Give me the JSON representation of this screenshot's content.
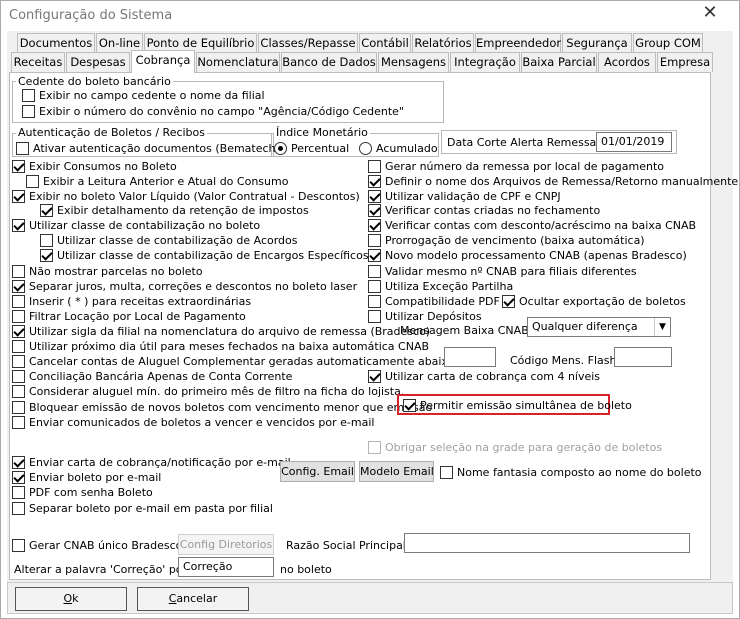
{
  "window": {
    "title": "Configuração do Sistema",
    "close_glyph": "✕"
  },
  "tabs_row1": [
    "Documentos",
    "On-line",
    "Ponto de Equilíbrio",
    "Classes/Repasse",
    "Contábil",
    "Relatórios",
    "Empreendedor",
    "Segurança",
    "Group COM"
  ],
  "tabs_row2": [
    "Receitas",
    "Despesas",
    "Cobrança",
    "Nomenclatura",
    "Banco de Dados",
    "Mensagens",
    "Integração",
    "Baixa Parcial",
    "Acordos",
    "Empresa"
  ],
  "active_tab": "Cobrança",
  "cedente": {
    "title": "Cedente do boleto bancário",
    "opt1": {
      "label": "Exibir no campo cedente o nome da filial",
      "checked": false
    },
    "opt2": {
      "label": "Exibir o número do convênio no campo \"Agência/Código Cedente\"",
      "checked": false
    }
  },
  "autent": {
    "title": "Autenticação de Boletos / Recibos",
    "opt": {
      "label": "Ativar autenticação documentos (Bematech)",
      "checked": false
    }
  },
  "indice": {
    "title": "Índice Monetário",
    "percentual": "Percentual",
    "acumulado": "Acumulado",
    "selected": "Percentual"
  },
  "data_corte": {
    "label": "Data Corte Alerta Remessa",
    "value": "01/01/2019"
  },
  "left_options": [
    {
      "label": "Exibir Consumos no Boleto",
      "checked": true
    },
    {
      "label": "Exibir a Leitura Anterior e Atual do Consumo",
      "checked": false
    },
    {
      "label": "Exibir no boleto Valor Líquido (Valor Contratual - Descontos)",
      "checked": true
    },
    {
      "label": "Exibir detalhamento da retenção de impostos",
      "checked": true
    },
    {
      "label": "Utilizar classe de contabilização no boleto",
      "checked": true
    },
    {
      "label": "Utilizar classe de contabilização de Acordos",
      "checked": false
    },
    {
      "label": "Utilizar classe de contabilização de Encargos Específicos",
      "checked": true
    },
    {
      "label": "Não mostrar parcelas no boleto",
      "checked": false
    },
    {
      "label": "Separar juros, multa, correções e descontos no boleto laser",
      "checked": true
    },
    {
      "label": "Inserir ( * ) para receitas extraordinárias",
      "checked": false
    },
    {
      "label": "Filtrar Locação por Local de Pagamento",
      "checked": false
    },
    {
      "label": "Utilizar sigla da filial na nomenclatura do arquivo de remessa (Bradesco)",
      "checked": true
    },
    {
      "label": "Utilizar próximo dia útil para meses fechados na baixa automática CNAB",
      "checked": false
    },
    {
      "label": "Cancelar contas de Aluguel Complementar geradas automaticamente abaixo de R$",
      "checked": false
    },
    {
      "label": "Conciliação Bancária Apenas de Conta Corrente",
      "checked": false
    },
    {
      "label": "Considerar aluguel mín. do primeiro mês de filtro na ficha do lojista.",
      "checked": false
    },
    {
      "label": "Bloquear emissão de novos boletos com vencimento menor que emissão",
      "checked": false
    },
    {
      "label": "Enviar comunicados de boletos a vencer e vencidos por e-mail",
      "checked": false
    }
  ],
  "right_options": [
    {
      "label": "Gerar número da remessa por local de pagamento",
      "checked": false
    },
    {
      "label": "Definir o nome dos Arquivos de Remessa/Retorno manualmente",
      "checked": true
    },
    {
      "label": "Utilizar validação de CPF e CNPJ",
      "checked": true
    },
    {
      "label": "Verificar contas criadas no fechamento",
      "checked": true
    },
    {
      "label": "Verificar contas com desconto/acréscimo na baixa CNAB",
      "checked": true
    },
    {
      "label": "Prorrogação de vencimento (baixa automática)",
      "checked": false
    },
    {
      "label": "Novo modelo processamento CNAB (apenas Bradesco)",
      "checked": true
    },
    {
      "label": "Validar mesmo nº CNAB para filiais diferentes",
      "checked": false
    },
    {
      "label": "Utiliza Exceção Partilha",
      "checked": false
    },
    {
      "label": "Compatibilidade PDF",
      "checked": false
    },
    {
      "label": "Utilizar Depósitos",
      "checked": false
    }
  ],
  "ocultar_exportacao": {
    "label": "Ocultar exportação de boletos",
    "checked": true
  },
  "mensagem_baixa": {
    "label": "Mensagem Baixa CNAB:",
    "value": "Qualquer diferença"
  },
  "codigo_mens": {
    "label": "Código Mens. Flash:",
    "value": ""
  },
  "valor_rs": "",
  "carta_4_niveis": {
    "label": "Utilizar carta de cobrança com 4 níveis",
    "checked": true
  },
  "permitir_simultanea": {
    "label": "Permitir emissão simultânea de boleto",
    "checked": true
  },
  "obrigar_selecao": {
    "label": "Obrigar seleção na grade para geração de boletos",
    "checked": false
  },
  "email_options": [
    {
      "label": "Enviar carta de cobrança/notificação por e-mail",
      "checked": true
    },
    {
      "label": "Enviar boleto por e-mail",
      "checked": true
    },
    {
      "label": "PDF com senha Boleto",
      "checked": false
    },
    {
      "label": "Separar boleto por e-mail em pasta por filial",
      "checked": false
    }
  ],
  "config_email_btn": "Config. Email",
  "modelo_email_btn": "Modelo Email",
  "nome_fantasia": {
    "label": "Nome fantasia composto ao nome do boleto",
    "checked": false
  },
  "gerar_cnab": {
    "label": "Gerar CNAB único Bradesco",
    "checked": false
  },
  "config_diretorios_btn": "Config Diretorios",
  "razao_social": {
    "label": "Razão Social Principal",
    "value": ""
  },
  "alterar_correcao": {
    "prefix": "Alterar a palavra 'Correção' por",
    "value": "Correção",
    "suffix": "no boleto"
  },
  "ok_btn": {
    "underlined": "O",
    "rest": "k"
  },
  "cancel_btn": {
    "underlined": "C",
    "rest": "ancelar"
  }
}
